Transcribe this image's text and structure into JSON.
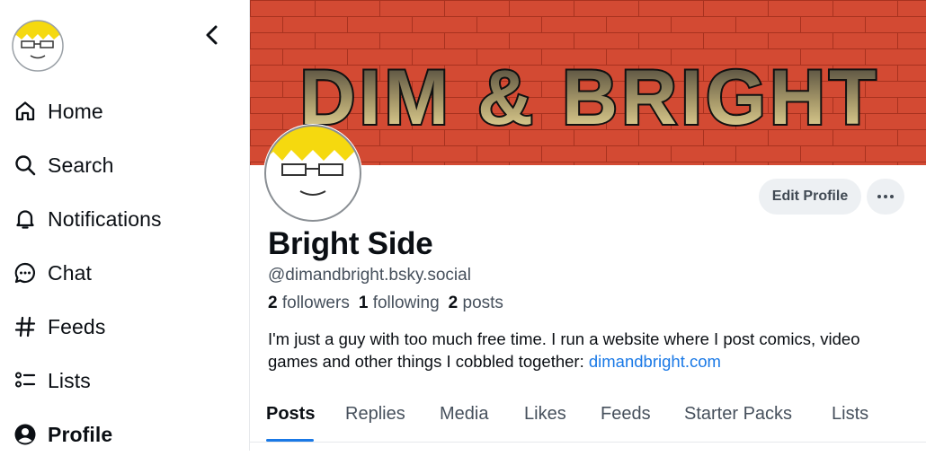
{
  "sidebar": {
    "nav": [
      {
        "label": "Home",
        "icon": "home-icon"
      },
      {
        "label": "Search",
        "icon": "search-icon"
      },
      {
        "label": "Notifications",
        "icon": "bell-icon"
      },
      {
        "label": "Chat",
        "icon": "chat-icon"
      },
      {
        "label": "Feeds",
        "icon": "hash-icon"
      },
      {
        "label": "Lists",
        "icon": "list-icon"
      },
      {
        "label": "Profile",
        "icon": "profile-icon",
        "active": true
      }
    ]
  },
  "banner": {
    "text": "DIM & BRIGHT",
    "bg_color": "#d34a33"
  },
  "profile": {
    "display_name": "Bright Side",
    "handle": "@dimandbright.bsky.social",
    "followers_count": "2",
    "followers_label": "followers",
    "following_count": "1",
    "following_label": "following",
    "posts_count": "2",
    "posts_label": "posts",
    "bio_text": "I'm just a guy with too much free time. I run a website where I post comics, video games and other things I cobbled together: ",
    "bio_link": "dimandbright.com",
    "edit_label": "Edit Profile",
    "more_icon": "ellipsis-icon"
  },
  "tabs": [
    "Posts",
    "Replies",
    "Media",
    "Likes",
    "Feeds",
    "Starter Packs",
    "Lists"
  ],
  "colors": {
    "accent": "#1a79e6",
    "button_bg": "#edf0f3"
  }
}
